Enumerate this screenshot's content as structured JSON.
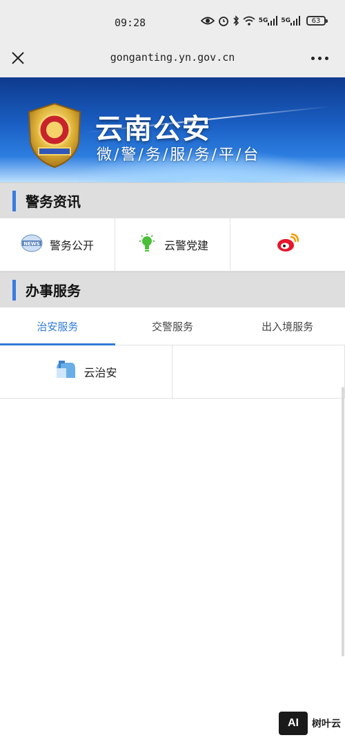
{
  "status_bar": {
    "time": "09:28",
    "signal1": "5G",
    "signal2": "5G",
    "battery": "63"
  },
  "nav": {
    "url": "gonganting.yn.gov.cn"
  },
  "banner": {
    "title": "云南公安",
    "subtitle": "微/警/务/服/务/平/台"
  },
  "section_news": {
    "title": "警务资讯",
    "items": [
      {
        "label": "警务公开",
        "icon": "news-icon"
      },
      {
        "label": "云警党建",
        "icon": "lightbulb-icon"
      },
      {
        "label": "",
        "icon": "weibo-icon"
      }
    ]
  },
  "section_services": {
    "title": "办事服务",
    "tabs": [
      "治安服务",
      "交警服务",
      "出入境服务"
    ],
    "active_tab": 0,
    "services": [
      {
        "label": "云治安",
        "icon": "mailbox-icon"
      }
    ]
  },
  "watermark": {
    "logo": "AI",
    "text": "树叶云"
  },
  "colors": {
    "accent": "#2f7ad6",
    "section_bar": "#3b7be0",
    "section_bg": "#dedede"
  }
}
